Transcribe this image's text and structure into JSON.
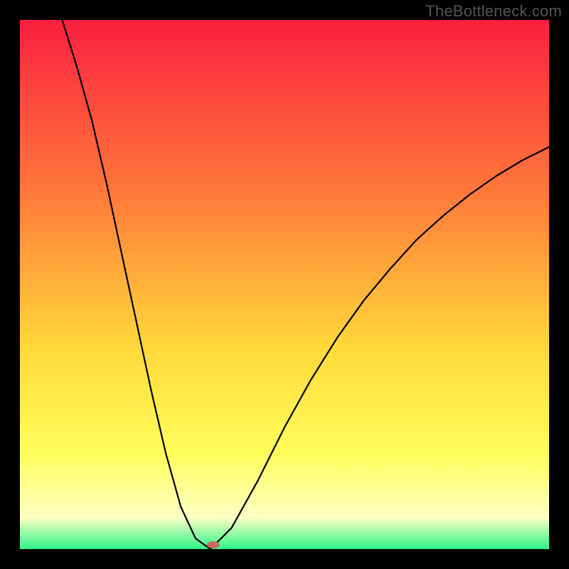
{
  "watermark": "TheBottleneck.com",
  "colors": {
    "gradient": {
      "top": "#fb1f3f",
      "mid1": "#ff7a3a",
      "mid2": "#ffd93a",
      "yellow": "#fffe5c",
      "pale": "#ffffc4",
      "green": "#2df58a"
    },
    "curve": "#000000",
    "dot": "#c96a62",
    "frame": "#000000"
  },
  "chart_data": {
    "type": "line",
    "title": "",
    "xlabel": "",
    "ylabel": "",
    "xlim": [
      0,
      100
    ],
    "ylim": [
      0,
      100
    ],
    "grid": false,
    "legend": false,
    "annotations": [],
    "minimum": {
      "x": 36,
      "y": 0
    },
    "dot": {
      "x": 36.5,
      "y": 0.8
    },
    "left_branch": {
      "x": [
        36,
        33.2,
        30.4,
        27.6,
        24.8,
        22.0,
        19.2,
        16.4,
        13.6,
        10.8,
        8.0
      ],
      "y": [
        0,
        2.0,
        8.0,
        18.0,
        30.0,
        43.0,
        56.0,
        69.0,
        81.0,
        91.0,
        100.0
      ]
    },
    "right_branch": {
      "x": [
        36,
        40,
        45,
        50,
        55,
        60,
        65,
        70,
        75,
        80,
        85,
        90,
        95,
        100
      ],
      "y": [
        0,
        4.0,
        13.0,
        23.0,
        32.0,
        40.0,
        47.0,
        53.0,
        58.5,
        63.0,
        67.0,
        70.5,
        73.5,
        76.0
      ]
    }
  }
}
